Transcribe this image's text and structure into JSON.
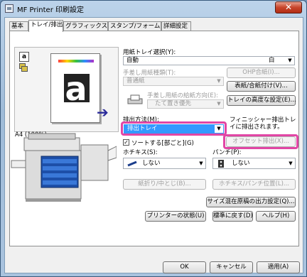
{
  "window": {
    "title": "MF Printer 印刷設定",
    "close_glyph": "✕"
  },
  "tabs": [
    {
      "label": "基本"
    },
    {
      "label": "トレイ/排出"
    },
    {
      "label": "グラフィックス"
    },
    {
      "label": "スタンプ/フォーム"
    },
    {
      "label": "詳細設定"
    }
  ],
  "preview": {
    "paper_label": "A4 (100%)",
    "page_letter": "a",
    "icon_letter": "a"
  },
  "tray_select": {
    "label": "用紙トレイ選択(Y):",
    "left_value": "自動",
    "right_value": "白"
  },
  "manual_paper_type": {
    "label": "手差し用紙種類(T):",
    "value": "普通紙"
  },
  "ohp_button": "OHP合紙(I)...",
  "cover_button": "表紙/合紙付け(V)...",
  "manual_orientation": {
    "label": "手差し用紙の給紙方向(E):",
    "value": "たて置き優先"
  },
  "tray_advanced_button": "トレイの高度な設定(E)...",
  "output_method": {
    "label": "排出方法(M):",
    "value": "排出トレイ"
  },
  "finisher_note": "フィニッシャー排出トレイに排出されます。",
  "offset_button": "オフセット排出(X)...",
  "sort_checkbox": {
    "label": "ソートする[部ごと](G)",
    "checked": true
  },
  "staple": {
    "label": "ホチキス(S):",
    "value": "しない"
  },
  "punch": {
    "label": "パンチ(P):",
    "value": "しない"
  },
  "fold_button": "紙折り/中とじ(B)...",
  "staple_punch_position_button": "ホチキス/パンチ位置(L)...",
  "mixed_size_button": "サイズ混在原稿の出力設定(Q)...",
  "printer_status_button": "プリンターの状態(U)",
  "restore_defaults_button": "標準に戻す(D)",
  "help_button": "ヘルプ(H)",
  "footer": {
    "ok": "OK",
    "cancel": "キャンセル",
    "apply": "適用(A)"
  },
  "colors": {
    "highlight": "#e146a5",
    "selected_bg": "#3399ff"
  }
}
